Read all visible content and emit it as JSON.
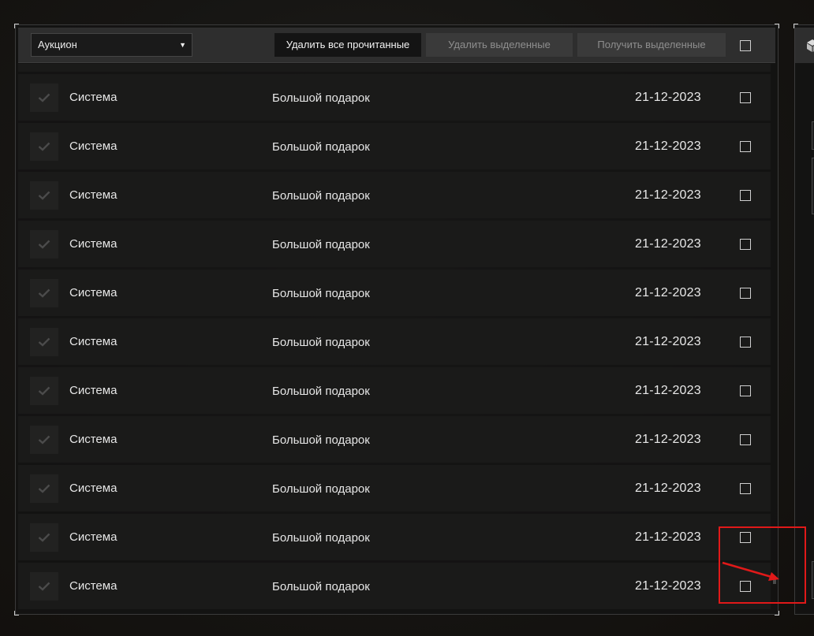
{
  "toolbar": {
    "dropdown_value": "Аукцион",
    "delete_read_label": "Удалить все прочитанные",
    "delete_selected_label": "Удалить выделенные",
    "receive_selected_label": "Получить выделенные"
  },
  "messages": [
    {
      "sender": "Система",
      "subject": "Большой подарок",
      "date": "21-12-2023"
    },
    {
      "sender": "Система",
      "subject": "Большой подарок",
      "date": "21-12-2023"
    },
    {
      "sender": "Система",
      "subject": "Большой подарок",
      "date": "21-12-2023"
    },
    {
      "sender": "Система",
      "subject": "Большой подарок",
      "date": "21-12-2023"
    },
    {
      "sender": "Система",
      "subject": "Большой подарок",
      "date": "21-12-2023"
    },
    {
      "sender": "Система",
      "subject": "Большой подарок",
      "date": "21-12-2023"
    },
    {
      "sender": "Система",
      "subject": "Большой подарок",
      "date": "21-12-2023"
    },
    {
      "sender": "Система",
      "subject": "Большой подарок",
      "date": "21-12-2023"
    },
    {
      "sender": "Система",
      "subject": "Большой подарок",
      "date": "21-12-2023"
    },
    {
      "sender": "Система",
      "subject": "Большой подарок",
      "date": "21-12-2023"
    },
    {
      "sender": "Система",
      "subject": "Большой подарок",
      "date": "21-12-2023"
    }
  ],
  "icons": {
    "row_icon": "checkmark-icon",
    "dropdown_icon": "triangle-down-icon",
    "side_header_icon": "cube-icon"
  },
  "colors": {
    "annotation": "#e01919",
    "toolbar_bg": "#2e2e2e",
    "row_bg": "#1a1a19"
  }
}
